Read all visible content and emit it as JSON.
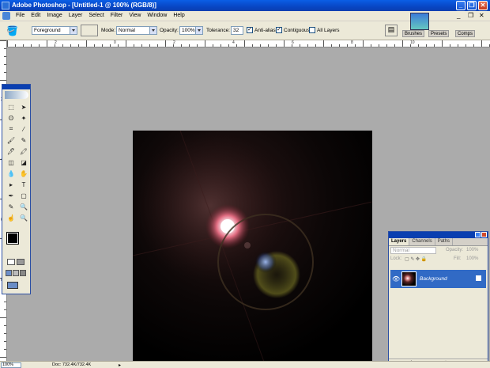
{
  "window": {
    "title": "Adobe Photoshop - [Untitled-1 @ 100% (RGB/8)]"
  },
  "menu": [
    "File",
    "Edit",
    "Image",
    "Layer",
    "Select",
    "Filter",
    "View",
    "Window",
    "Help"
  ],
  "options": {
    "source_value": "Foreground",
    "mode_label": "Mode:",
    "mode_value": "Normal",
    "opacity_label": "Opacity:",
    "opacity_value": "100%",
    "tolerance_label": "Tolerance:",
    "tolerance_value": "32",
    "antialias_label": "Anti-alias",
    "contiguous_label": "Contiguous",
    "all_layers_label": "All Layers",
    "palette_tabs": [
      "Brushes",
      "Presets",
      "Comps"
    ]
  },
  "ruler": {
    "top_labels": [
      "2",
      "0",
      "2",
      "4",
      "6",
      "8",
      "10"
    ],
    "left_labels": [
      "2",
      "4",
      "6",
      "8"
    ]
  },
  "tools": {
    "glyphs": [
      "⬚",
      "➤",
      "ʘ",
      "✦",
      "⌗",
      "⁄",
      "🖌",
      "✎",
      "🖊",
      "🖍",
      "◫",
      "◪",
      "💧",
      "✋",
      "▸",
      "T",
      "✒",
      "▢",
      "✎",
      "🔍",
      "☝",
      "🔍"
    ]
  },
  "layers_panel": {
    "tabs": [
      "Layers",
      "Channels",
      "Paths"
    ],
    "blend_mode": "Normal",
    "opacity_label": "Opacity:",
    "opacity_value": "100%",
    "lock_label": "Lock:",
    "fill_label": "Fill:",
    "fill_value": "100%",
    "layer_name": "Background"
  },
  "status": {
    "zoom": "100%",
    "doc_info": "Doc: 732.4K/732.4K"
  },
  "colors": {
    "titlebar": "#0846c4",
    "selection": "#316ac5",
    "panel_bg": "#ece9d8",
    "workspace": "#ababab"
  }
}
